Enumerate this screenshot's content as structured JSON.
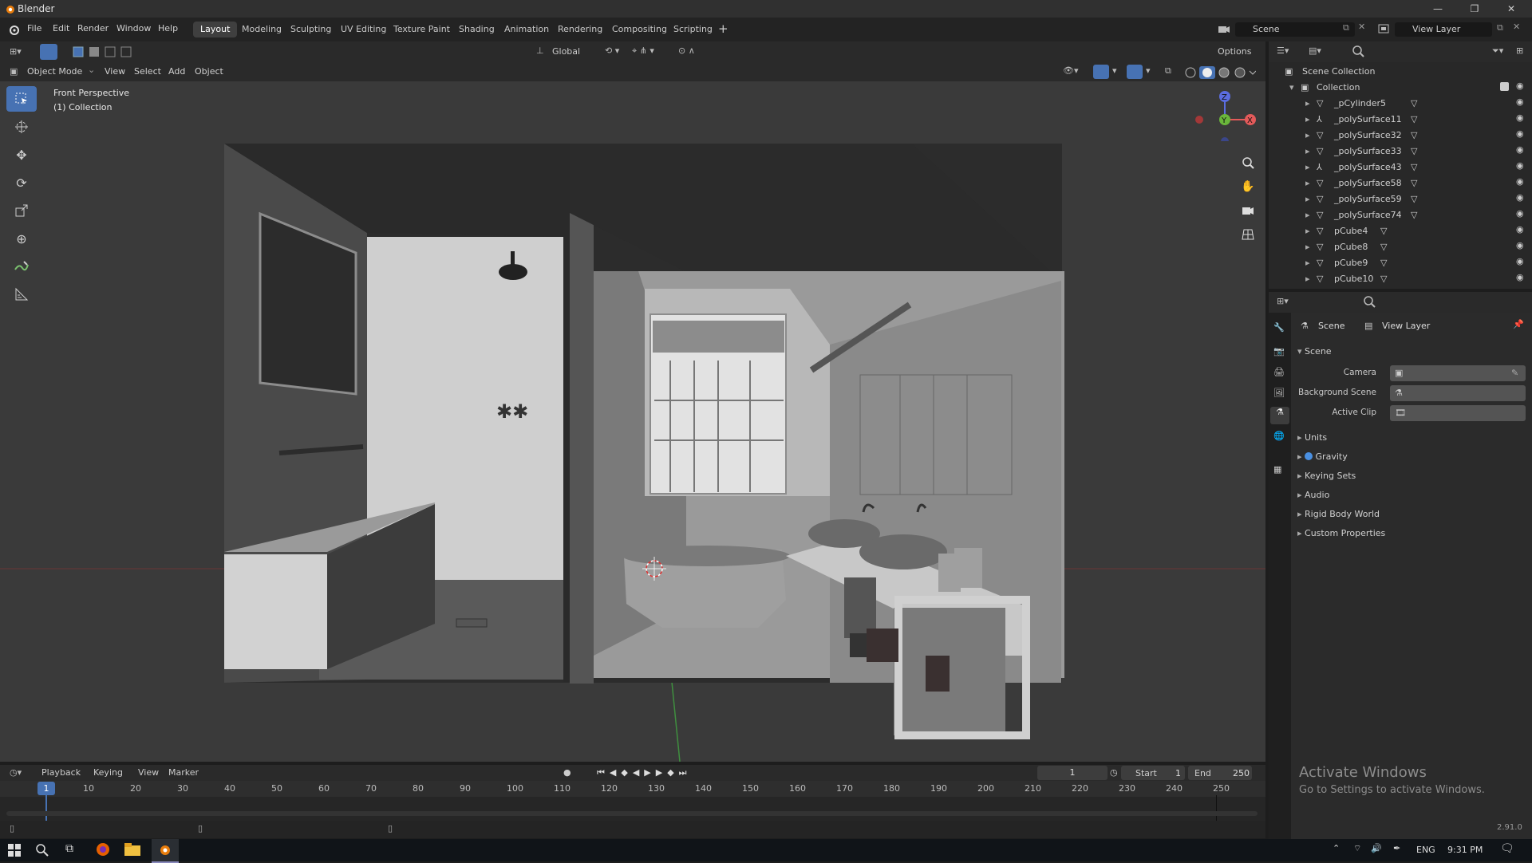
{
  "window": {
    "title": "Blender"
  },
  "menu": [
    "File",
    "Edit",
    "Render",
    "Window",
    "Help"
  ],
  "workspaces": [
    "Layout",
    "Modeling",
    "Sculpting",
    "UV Editing",
    "Texture Paint",
    "Shading",
    "Animation",
    "Rendering",
    "Compositing",
    "Scripting"
  ],
  "workspace_add": "+",
  "scene_field": "Scene",
  "viewlayer_field": "View Layer",
  "tool_header": {
    "orientation": "Global",
    "options": "Options"
  },
  "viewport_header": {
    "mode": "Object Mode",
    "items": [
      "View",
      "Select",
      "Add",
      "Object"
    ]
  },
  "viewport_info": {
    "perspective": "Front Perspective",
    "collection": "(1) Collection"
  },
  "outliner": {
    "root": "Scene Collection",
    "collection": "Collection",
    "items": [
      "_pCylinder5",
      "_polySurface11",
      "_polySurface32",
      "_polySurface33",
      "_polySurface43",
      "_polySurface58",
      "_polySurface59",
      "_polySurface74",
      "pCube4",
      "pCube8",
      "pCube9",
      "pCube10"
    ]
  },
  "properties": {
    "breadcrumb_scene": "Scene",
    "breadcrumb_layer": "View Layer",
    "section": "Scene",
    "fields": [
      {
        "label": "Camera"
      },
      {
        "label": "Background Scene"
      },
      {
        "label": "Active Clip"
      }
    ],
    "subsections": [
      "Units",
      "Gravity",
      "Keying Sets",
      "Audio",
      "Rigid Body World",
      "Custom Properties"
    ]
  },
  "timeline": {
    "menus": [
      "Playback",
      "Keying",
      "View",
      "Marker"
    ],
    "current_frame": "1",
    "start_label": "Start",
    "start": "1",
    "end_label": "End",
    "end": "250",
    "ticks": [
      "10",
      "20",
      "30",
      "40",
      "50",
      "60",
      "70",
      "80",
      "90",
      "100",
      "110",
      "120",
      "130",
      "140",
      "150",
      "160",
      "170",
      "180",
      "190",
      "200",
      "210",
      "220",
      "230",
      "240",
      "250"
    ],
    "playhead": "1"
  },
  "watermark": {
    "line1": "Activate Windows",
    "line2": "Go to Settings to activate Windows."
  },
  "version": "2.91.0",
  "taskbar": {
    "lang": "ENG",
    "time": "9:31 PM"
  }
}
